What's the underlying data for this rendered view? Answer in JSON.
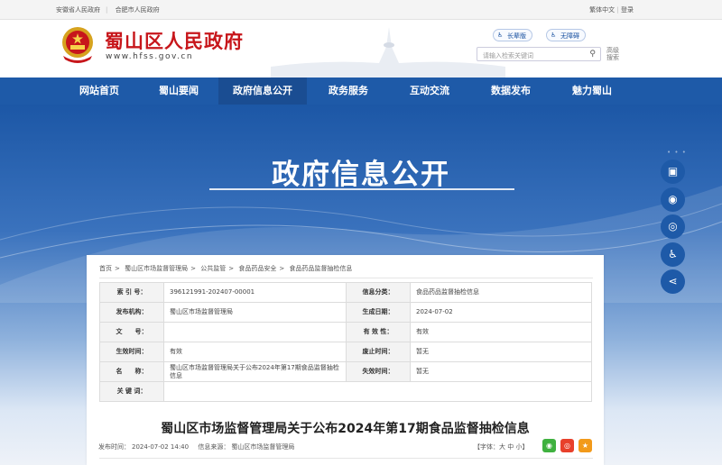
{
  "topbar": {
    "links": [
      "安徽省人民政府",
      "合肥市人民政府"
    ],
    "right": [
      "繁体中文",
      "登录"
    ]
  },
  "header": {
    "site_name": "蜀山区人民政府",
    "site_url": "www.hfss.gov.cn",
    "modes": [
      "长辈版",
      "无障碍"
    ],
    "search_placeholder": "请输入检索关键词",
    "advanced_search": "高级搜索"
  },
  "nav": {
    "items": [
      "网站首页",
      "蜀山要闻",
      "政府信息公开",
      "政务服务",
      "互动交流",
      "数据发布",
      "魅力蜀山"
    ],
    "active_index": 2
  },
  "banner": {
    "title": "政府信息公开"
  },
  "side_tools": [
    "government-icon",
    "wechat-icon",
    "weibo-icon",
    "accessibility-icon",
    "share-icon"
  ],
  "breadcrumb": [
    "首页",
    "蜀山区市场监督管理局",
    "公共监管",
    "食品药品安全",
    "食品药品监督抽检信息"
  ],
  "meta": [
    {
      "k1": "索 引 号：",
      "v1": "396121991-202407-00001",
      "k2": "信息分类：",
      "v2": "食品药品监督抽检信息"
    },
    {
      "k1": "发布机构：",
      "v1": "蜀山区市场监督管理局",
      "k2": "生成日期：",
      "v2": "2024-07-02"
    },
    {
      "k1": "文　　号：",
      "v1": "",
      "k2": "有 效 性：",
      "v2": "有效"
    },
    {
      "k1": "生效时间：",
      "v1": "有效",
      "k2": "废止时间：",
      "v2": "暂无"
    },
    {
      "k1": "名　　称：",
      "v1": "蜀山区市场监督管理局关于公布2024年第17期食品监督抽检信息",
      "k2": "失效时间：",
      "v2": "暂无"
    },
    {
      "k1": "关 键 词：",
      "v1": "",
      "k2": "",
      "v2": ""
    }
  ],
  "article": {
    "title": "蜀山区市场监督管理局关于公布2024年第17期食品监督抽检信息",
    "publish_label": "发布时间：",
    "publish_time": "2024-07-02 14:40",
    "source_label": "信息来源：",
    "source": "蜀山区市场监督管理局",
    "font_size_text": "【字体：大 中 小】"
  },
  "colors": {
    "brand_red": "#c7161b",
    "nav_blue": "#1e5aa8",
    "wechat": "#3fb13f",
    "weibo": "#e8402b",
    "favorite": "#f29a1a"
  }
}
